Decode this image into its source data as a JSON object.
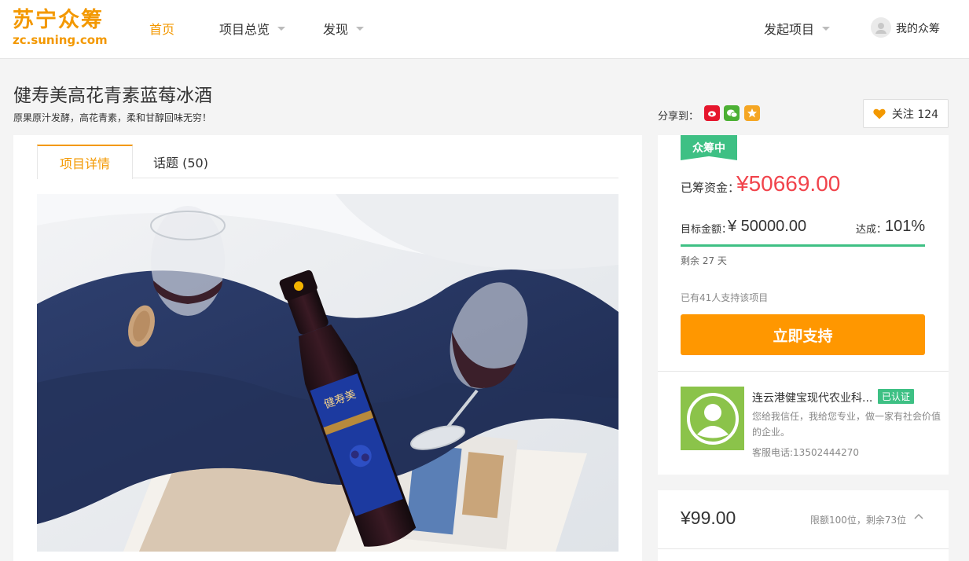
{
  "header": {
    "logo_cn": "苏宁众筹",
    "logo_en": "zc.suning.com",
    "nav": [
      {
        "label": "首页"
      },
      {
        "label": "项目总览"
      },
      {
        "label": "发现"
      }
    ],
    "launch_label": "发起项目",
    "my_label": "我的众筹"
  },
  "project": {
    "title": "健寿美高花青素蓝莓冰酒",
    "subtitle": "原果原汁发酵，高花青素，柔和甘醇回味无穷！",
    "share_label": "分享到：",
    "follow_label": "关注 124"
  },
  "tabs": {
    "details": "项目详情",
    "topics": "话题 (50)"
  },
  "funding": {
    "status": "众筹中",
    "raised_label": "已筹资金：",
    "raised_amount": "¥50669.00",
    "target_label": "目标金额：",
    "target_value": "¥ 50000.00",
    "rate_label": "达成：",
    "rate_value": "101%",
    "progress_fraction": 1.0,
    "days_left": "剩余 27 天",
    "supporters": "已有41人支持该项目",
    "support_button": "立即支持"
  },
  "company": {
    "name": "连云港健宝现代农业科...",
    "verified": "已认证",
    "desc": "您给我信任，我给您专业，做一家有社会价值的企业。",
    "phone": "客服电话:13502444270"
  },
  "tier": {
    "price": "¥99.00",
    "limit": "限额100位，剩余73位"
  },
  "colors": {
    "brand": "#f39800",
    "accent_green": "#3ec084",
    "price_red": "#f1434b",
    "button_orange": "#ff9700"
  }
}
